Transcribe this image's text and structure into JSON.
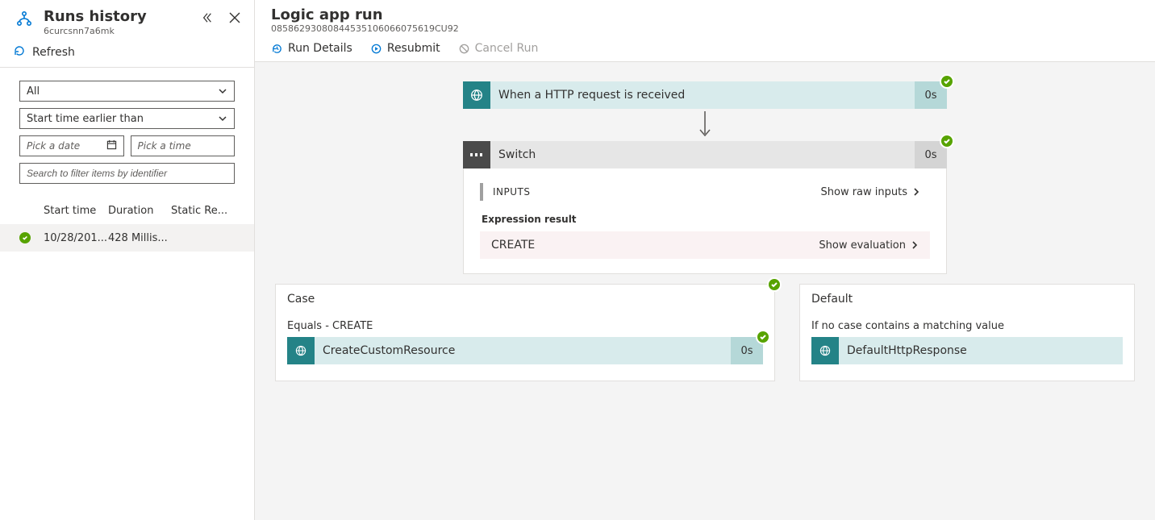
{
  "left": {
    "title": "Runs history",
    "subtitle": "6curcsnn7a6mk",
    "refresh": "Refresh",
    "filters": {
      "status": "All",
      "timeMode": "Start time earlier than",
      "datePlaceholder": "Pick a date",
      "timePlaceholder": "Pick a time",
      "searchPlaceholder": "Search to filter items by identifier"
    },
    "table": {
      "cols": {
        "start": "Start time",
        "duration": "Duration",
        "static": "Static Re..."
      },
      "rows": [
        {
          "status": "success",
          "start": "10/28/201...",
          "duration": "428 Millis...",
          "static": ""
        }
      ]
    }
  },
  "right": {
    "title": "Logic app run",
    "subtitle": "08586293080844535106066075619CU92",
    "toolbar": {
      "details": "Run Details",
      "resubmit": "Resubmit",
      "cancel": "Cancel Run"
    },
    "flow": {
      "http": {
        "title": "When a HTTP request is received",
        "time": "0s"
      },
      "switch": {
        "title": "Switch",
        "time": "0s",
        "inputsHeader": "INPUTS",
        "showRaw": "Show raw inputs",
        "exprLabel": "Expression result",
        "exprValue": "CREATE",
        "showEval": "Show evaluation"
      },
      "case": {
        "title": "Case",
        "subtitle": "Equals - CREATE",
        "step": {
          "title": "CreateCustomResource",
          "time": "0s"
        }
      },
      "default": {
        "title": "Default",
        "subtitle": "If no case contains a matching value",
        "step": {
          "title": "DefaultHttpResponse"
        }
      }
    }
  }
}
